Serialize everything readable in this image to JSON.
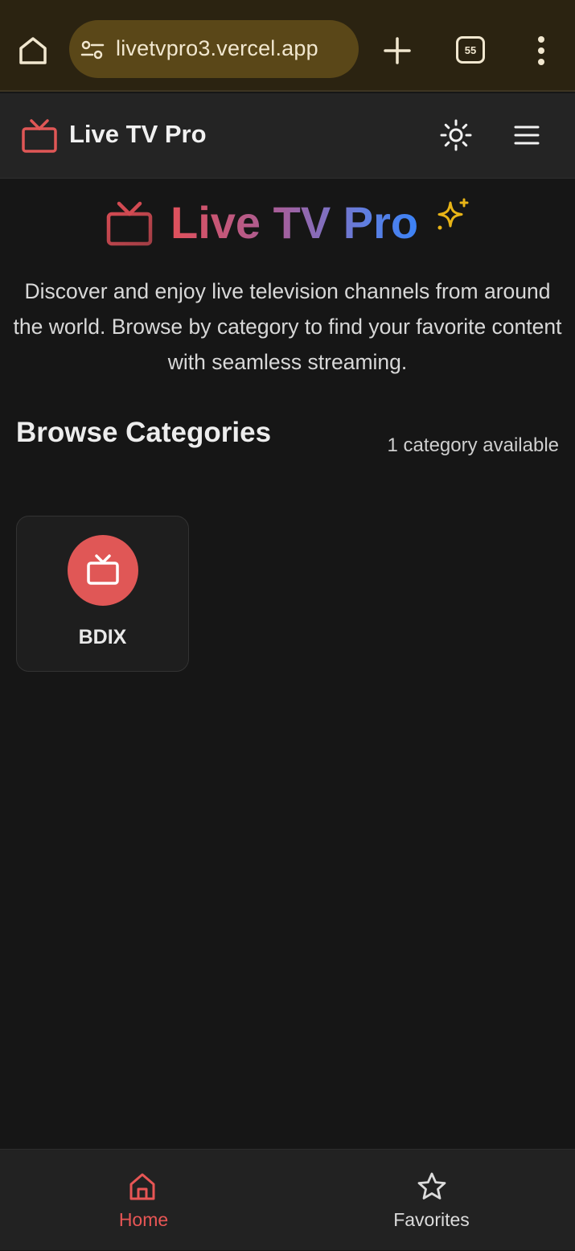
{
  "browser": {
    "url": "livetvpro3.vercel.app",
    "tab_count": "55"
  },
  "header": {
    "title": "Live TV Pro"
  },
  "hero": {
    "title": "Live TV Pro",
    "description": "Discover and enjoy live television channels from around the world. Browse by category to find your favorite content with seamless streaming."
  },
  "section": {
    "title": "Browse Categories",
    "count_text": "1 category available"
  },
  "categories": [
    {
      "label": "BDIX",
      "icon": "tv-icon",
      "color": "#e05756"
    }
  ],
  "bottom_nav": {
    "items": [
      {
        "label": "Home",
        "icon": "home-icon",
        "active": true
      },
      {
        "label": "Favorites",
        "icon": "star-icon",
        "active": false
      }
    ]
  },
  "colors": {
    "accent": "#e05756",
    "background": "#161616",
    "browser_bar": "#2b2311",
    "url_pill": "#5a4718",
    "sparkle": "#e8b417"
  }
}
